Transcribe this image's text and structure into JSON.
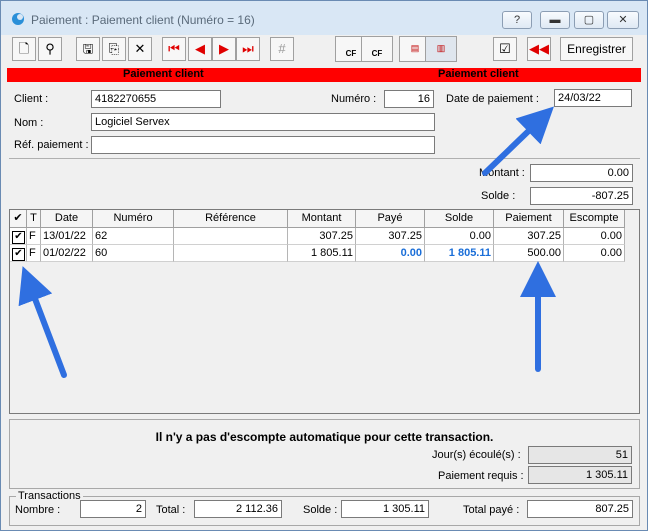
{
  "window": {
    "title": "Paiement : Paiement client (Numéro = 16)",
    "help_label": "?"
  },
  "toolbar": {
    "save_label": "Enregistrer",
    "cf_label": "CF",
    "cf2_label": "CF"
  },
  "header": {
    "left": "Paiement client",
    "right": "Paiement client"
  },
  "form": {
    "client_label": "Client :",
    "client_value": "4182270655",
    "numero_label": "Numéro :",
    "numero_value": "16",
    "date_label": "Date de paiement :",
    "date_value": "24/03/22",
    "nom_label": "Nom :",
    "nom_value": "Logiciel Servex",
    "ref_label": "Réf. paiement :",
    "ref_value": "",
    "montant_label": "Montant :",
    "montant_value": "0.00",
    "solde_label": "Solde :",
    "solde_value": "-807.25"
  },
  "table": {
    "columns": [
      "✔",
      "T",
      "Date",
      "Numéro",
      "Référence",
      "Montant",
      "Payé",
      "Solde",
      "Paiement",
      "Escompte"
    ],
    "rows": [
      {
        "check": "✔",
        "t": "F",
        "date": "13/01/22",
        "numero": "62",
        "ref": "",
        "montant": "307.25",
        "paye": "307.25",
        "solde": "0.00",
        "paiement": "307.25",
        "escompte": "0.00"
      },
      {
        "check": "✔",
        "t": "F",
        "date": "01/02/22",
        "numero": "60",
        "ref": "",
        "montant": "1 805.11",
        "paye": "0.00",
        "solde": "1 805.11",
        "paiement": "500.00",
        "escompte": "0.00"
      }
    ]
  },
  "info": {
    "message": "Il n'y a pas d'escompte automatique pour cette transaction.",
    "jours_label": "Jour(s) écoulé(s) :",
    "jours_value": "51",
    "requis_label": "Paiement requis :",
    "requis_value": "1 305.11"
  },
  "totals": {
    "group_label": "Transactions",
    "nombre_label": "Nombre :",
    "nombre_value": "2",
    "total_label": "Total :",
    "total_value": "2 112.36",
    "solde_label": "Solde :",
    "solde_value": "1 305.11",
    "paye_label": "Total payé :",
    "paye_value": "807.25"
  },
  "colors": {
    "accent": "#ff0000",
    "highlight": "#1a6ed8",
    "arrow": "#2f6fe0"
  }
}
